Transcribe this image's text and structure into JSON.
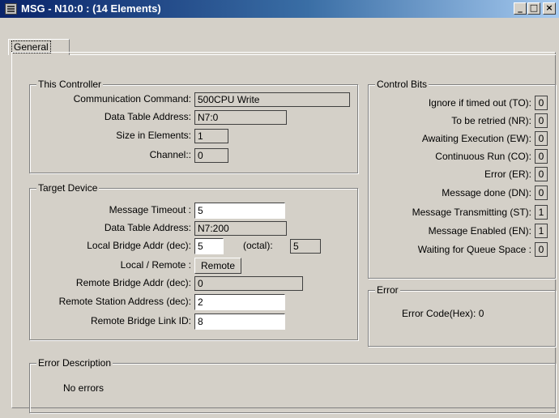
{
  "window": {
    "title": "MSG - N10:0 : (14 Elements)",
    "min": "_",
    "max": "□",
    "close": "×"
  },
  "tabs": [
    {
      "label": "General"
    }
  ],
  "this_controller": {
    "title": "This Controller",
    "fields": [
      {
        "label": "Communication Command:",
        "value": "500CPU Write"
      },
      {
        "label": "Data Table Address:",
        "value": "N7:0"
      },
      {
        "label": "Size in Elements:",
        "value": "1"
      },
      {
        "label": "Channel::",
        "value": "0"
      }
    ]
  },
  "target_device": {
    "title": "Target Device",
    "timeout": {
      "label": "Message Timeout :",
      "value": "5"
    },
    "data_table": {
      "label": "Data Table Address:",
      "value": "N7:200"
    },
    "local_bridge": {
      "label": "Local Bridge Addr (dec):",
      "value": "5",
      "octal_label": "(octal):",
      "octal_value": "5"
    },
    "local_remote": {
      "label": "Local / Remote :",
      "value": "Remote"
    },
    "remote_bridge": {
      "label": "Remote Bridge Addr (dec):",
      "value": "0"
    },
    "remote_station": {
      "label": "Remote Station Address (dec):",
      "value": "2"
    },
    "remote_link": {
      "label": "Remote Bridge Link ID:",
      "value": "8"
    }
  },
  "control_bits": {
    "title": "Control Bits",
    "bits": [
      {
        "label": "Ignore if timed out (TO):",
        "value": "0"
      },
      {
        "label": "To be retried (NR):",
        "value": "0"
      },
      {
        "label": "Awaiting Execution (EW):",
        "value": "0"
      },
      {
        "label": "Continuous Run (CO):",
        "value": "0"
      },
      {
        "label": "Error (ER):",
        "value": "0"
      },
      {
        "label": "Message done (DN):",
        "value": "0"
      },
      {
        "label": "Message Transmitting (ST):",
        "value": "1"
      },
      {
        "label": "Message Enabled (EN):",
        "value": "1"
      },
      {
        "label": "Waiting for Queue Space :",
        "value": "0"
      }
    ]
  },
  "error": {
    "title": "Error",
    "text": "Error Code(Hex): 0"
  },
  "error_description": {
    "title": "Error Description",
    "text": "No errors"
  }
}
